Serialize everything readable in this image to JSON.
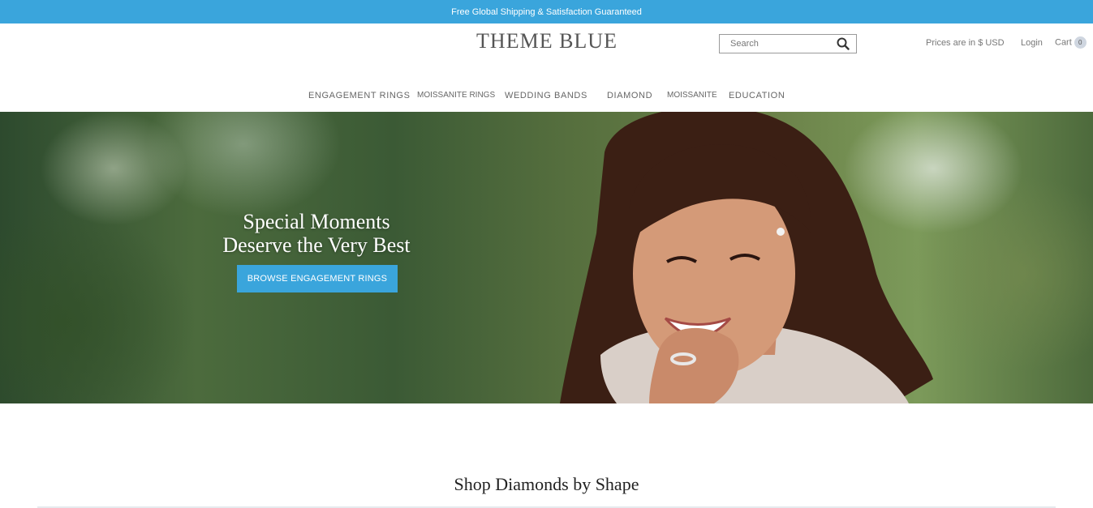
{
  "announcement": "Free Global Shipping & Satisfaction Guaranteed",
  "header": {
    "logo": "THEME BLUE",
    "search_placeholder": "Search",
    "currency_text": "Prices are in $ USD",
    "login_label": "Login",
    "cart_label": "Cart",
    "cart_count": "0"
  },
  "nav": {
    "items": [
      "ENGAGEMENT RINGS",
      "MOISSANITE RINGS",
      "WEDDING BANDS",
      "DIAMOND",
      "MOISSANITE",
      "EDUCATION"
    ]
  },
  "hero": {
    "title_line1": "Special Moments",
    "title_line2": "Deserve the Very Best",
    "button_label": "BROWSE ENGAGEMENT RINGS"
  },
  "section": {
    "title": "Shop Diamonds by Shape"
  },
  "colors": {
    "accent": "#3aa5dc",
    "text": "#555555"
  }
}
